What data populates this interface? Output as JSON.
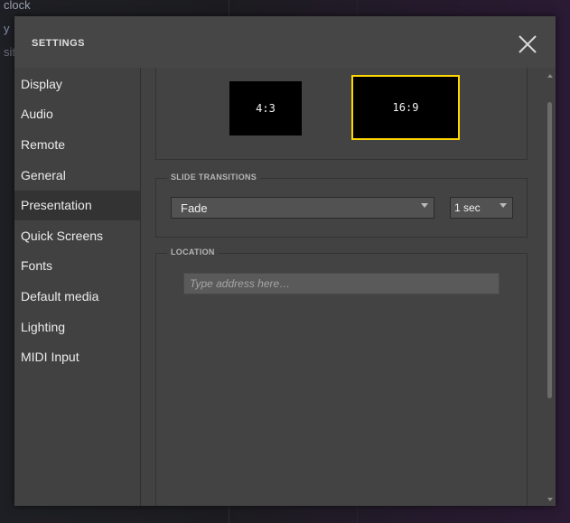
{
  "background": {
    "line1": "clock",
    "line2": "y",
    "line3": "sit"
  },
  "dialog": {
    "title": "SETTINGS",
    "close_icon": "close-icon"
  },
  "sidebar": {
    "items": [
      {
        "label": "Display"
      },
      {
        "label": "Audio"
      },
      {
        "label": "Remote"
      },
      {
        "label": "General"
      },
      {
        "label": "Presentation",
        "active": true
      },
      {
        "label": "Quick Screens"
      },
      {
        "label": "Fonts"
      },
      {
        "label": "Default media"
      },
      {
        "label": "Lighting"
      },
      {
        "label": "MIDI Input"
      }
    ]
  },
  "aspect": {
    "options": [
      "4:3",
      "16:9"
    ],
    "selected": "16:9",
    "selected_color": "#ffd700"
  },
  "slide_transitions": {
    "legend": "SLIDE TRANSITIONS",
    "effect": "Fade",
    "duration": "1 sec"
  },
  "location": {
    "legend": "LOCATION",
    "placeholder": "Type address here…",
    "value": ""
  },
  "colors": {
    "dialog_bg": "#444444",
    "active_item_bg": "#333333",
    "accent": "#ffd700"
  }
}
